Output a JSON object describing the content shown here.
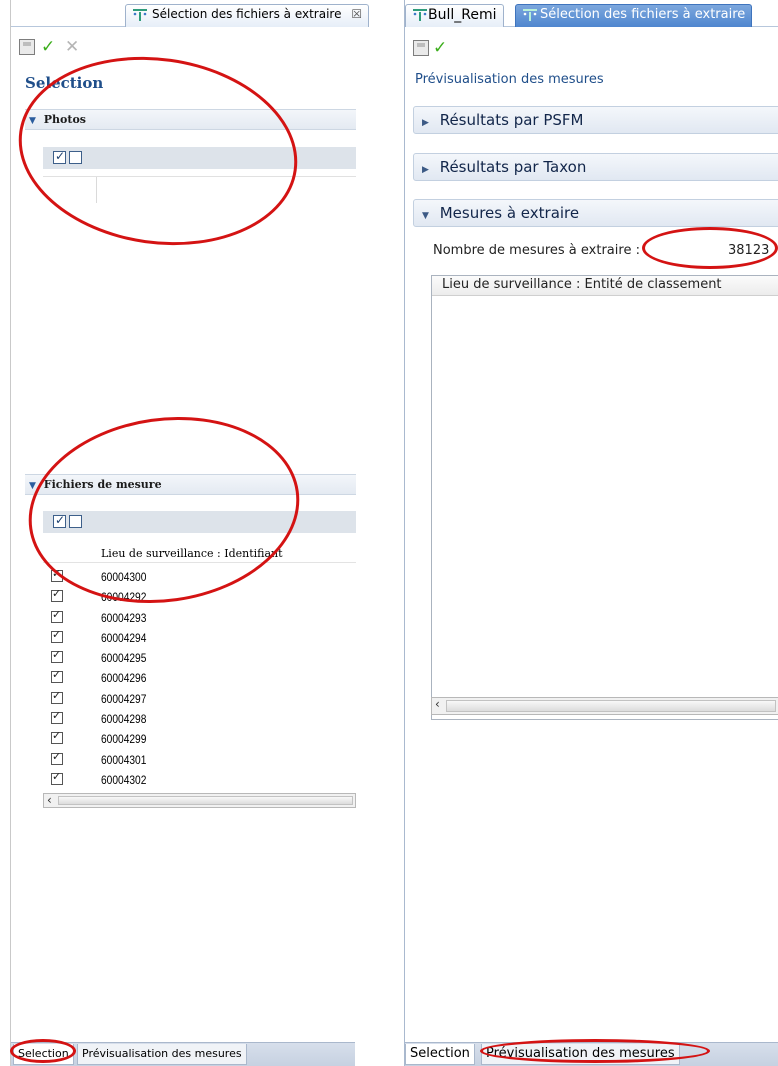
{
  "left": {
    "tab_title": "Sélection des fichiers à extraire",
    "tab_close": "☒",
    "toolbar": {
      "save_icon": "save-icon",
      "check_icon": "✓",
      "cancel_icon": "✕"
    },
    "title": "Selection",
    "photos_section": {
      "label": "Photos"
    },
    "fichiers_section": {
      "label": "Fichiers de mesure",
      "column_header": "Lieu de surveillance : Identifiant",
      "rows": [
        "60004300",
        "60004292",
        "60004293",
        "60004294",
        "60004295",
        "60004296",
        "60004297",
        "60004298",
        "60004299",
        "60004301",
        "60004302"
      ]
    },
    "bottom_tabs": {
      "tab1": "Selection",
      "tab2": "Prévisualisation des mesures"
    },
    "scroll_arrow": "‹"
  },
  "right": {
    "tab_bull": "Bull_Remi",
    "tab_selection": "Sélection des fichiers à extraire",
    "title": "Prévisualisation des mesures",
    "accordion": {
      "psfm": "Résultats par PSFM",
      "taxon": "Résultats par Taxon",
      "mesures": "Mesures à extraire"
    },
    "count_label": "Nombre de mesures à extraire :",
    "count_value": "38123",
    "table_header": "Lieu de surveillance : Entité de classement",
    "bottom_tabs": {
      "tab1": "Selection",
      "tab2": "Prévisualisation des mesures"
    },
    "scroll_arrow": "‹",
    "scroll_mid": "III"
  },
  "colors": {
    "accent": "#1f4e8a",
    "annotation": "#d41313",
    "active_tab": "#4f86cf",
    "check_green": "#3cae1c"
  }
}
